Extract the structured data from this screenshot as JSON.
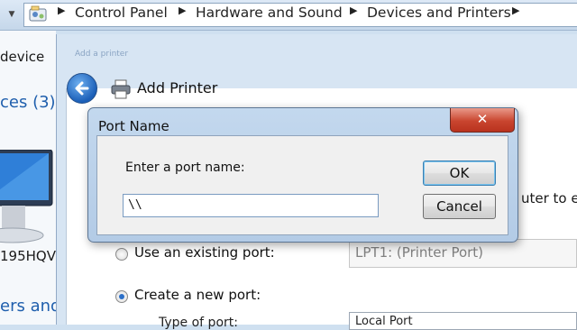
{
  "explorer": {
    "breadcrumb": [
      "Control Panel",
      "Hardware and Sound",
      "Devices and Printers"
    ],
    "left_pane": {
      "add_device": "device",
      "devices_group": "ces (3)",
      "device_caption": "195HQV",
      "printers_group": "ers and"
    }
  },
  "wizard": {
    "title": "Add Printer",
    "ghost_title": "Add a printer",
    "behind_text": "uter to ex",
    "options": [
      {
        "label": "Use an existing port:",
        "selected": false
      },
      {
        "label": "Create a new port:",
        "selected": true
      }
    ],
    "existing_port_value": "LPT1: (Printer Port)",
    "port_type_label": "Type of port:",
    "port_type_value": "Local Port"
  },
  "dialog": {
    "title": "Port Name",
    "close_label": "✕",
    "prompt": "Enter a port name:",
    "input_value": "\\\\",
    "ok_label": "OK",
    "cancel_label": "Cancel"
  },
  "icons": [
    "control-panel-icon",
    "back-arrow-icon",
    "printer-icon",
    "monitor-icon",
    "close-icon"
  ]
}
